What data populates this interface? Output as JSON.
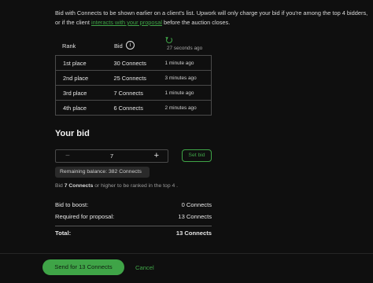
{
  "intro": {
    "text_before": "Bid with Connects to be shown earlier on a client's list. Upwork will only charge your bid if you're among the top 4 bidders, or if the client ",
    "link": "interacts with your proposal",
    "text_after": " before the auction closes."
  },
  "table": {
    "headers": {
      "rank": "Rank",
      "bid": "Bid",
      "info_icon": "info-icon"
    },
    "updated": "27 seconds ago",
    "rows": [
      {
        "rank": "1st place",
        "bid": "30 Connects",
        "time": "1 minute ago"
      },
      {
        "rank": "2nd place",
        "bid": "25 Connects",
        "time": "3 minutes ago"
      },
      {
        "rank": "3rd place",
        "bid": "7 Connects",
        "time": "1 minute ago"
      },
      {
        "rank": "4th place",
        "bid": "6 Connects",
        "time": "2 minutes ago"
      }
    ]
  },
  "bid": {
    "title": "Your bid",
    "minus": "−",
    "value": "7",
    "plus": "+",
    "set_label": "Set bid",
    "balance": "Remaining balance: 382 Connects",
    "hint_prefix": "Bid ",
    "hint_bold": "7 Connects",
    "hint_suffix": " or higher to be ranked in the top 4 ."
  },
  "summary": {
    "boost_label": "Bid to boost:",
    "boost_value": "0 Connects",
    "required_label": "Required for proposal:",
    "required_value": "13 Connects",
    "total_label": "Total:",
    "total_value": "13 Connects"
  },
  "footer": {
    "send_label": "Send for 13 Connects",
    "cancel_label": "Cancel"
  },
  "colors": {
    "accent": "#3fa447",
    "background": "#0f0f0f"
  }
}
